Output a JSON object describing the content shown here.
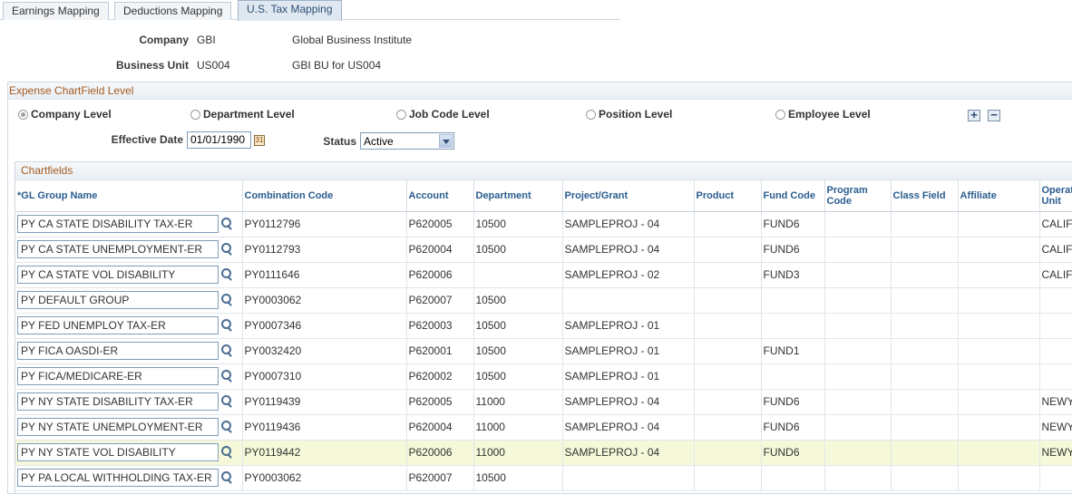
{
  "tabs": [
    {
      "label": "Earnings Mapping"
    },
    {
      "label": "Deductions Mapping"
    },
    {
      "label": "U.S. Tax Mapping"
    }
  ],
  "header": {
    "company_label": "Company",
    "company_code": "GBI",
    "company_name": "Global Business Institute",
    "bu_label": "Business Unit",
    "bu_code": "US004",
    "bu_name": "GBI BU for US004"
  },
  "expense": {
    "title": "Expense ChartField Level",
    "levels": [
      {
        "label": "Company Level",
        "selected": true
      },
      {
        "label": "Department Level",
        "selected": false
      },
      {
        "label": "Job Code Level",
        "selected": false
      },
      {
        "label": "Position Level",
        "selected": false
      },
      {
        "label": "Employee Level",
        "selected": false
      }
    ],
    "add_symbol": "+",
    "remove_symbol": "−",
    "eff_date_label": "Effective Date",
    "eff_date_value": "01/01/1990",
    "status_label": "Status",
    "status_value": "Active"
  },
  "chartfields": {
    "title": "Chartfields",
    "columns": [
      "*GL Group Name",
      "Combination Code",
      "Account",
      "Department",
      "Project/Grant",
      "Product",
      "Fund Code",
      "Program Code",
      "Class Field",
      "Affiliate",
      "Operating Unit"
    ],
    "rows": [
      [
        "PY CA STATE DISABILITY TAX-ER",
        "PY0112796",
        "P620005",
        "10500",
        "SAMPLEPROJ - 04",
        "",
        "FUND6",
        "",
        "",
        "",
        "CALIF"
      ],
      [
        "PY CA STATE UNEMPLOYMENT-ER",
        "PY0112793",
        "P620004",
        "10500",
        "SAMPLEPROJ - 04",
        "",
        "FUND6",
        "",
        "",
        "",
        "CALIF"
      ],
      [
        "PY CA STATE VOL DISABILITY",
        "PY0111646",
        "P620006",
        "",
        "SAMPLEPROJ - 02",
        "",
        "FUND3",
        "",
        "",
        "",
        "CALIF"
      ],
      [
        "PY DEFAULT GROUP",
        "PY0003062",
        "P620007",
        "10500",
        "",
        "",
        "",
        "",
        "",
        "",
        ""
      ],
      [
        "PY FED UNEMPLOY TAX-ER",
        "PY0007346",
        "P620003",
        "10500",
        "SAMPLEPROJ - 01",
        "",
        "",
        "",
        "",
        "",
        ""
      ],
      [
        "PY FICA OASDI-ER",
        "PY0032420",
        "P620001",
        "10500",
        "SAMPLEPROJ - 01",
        "",
        "FUND1",
        "",
        "",
        "",
        ""
      ],
      [
        "PY FICA/MEDICARE-ER",
        "PY0007310",
        "P620002",
        "10500",
        "SAMPLEPROJ - 01",
        "",
        "",
        "",
        "",
        "",
        ""
      ],
      [
        "PY NY STATE DISABILITY TAX-ER",
        "PY0119439",
        "P620005",
        "11000",
        "SAMPLEPROJ - 04",
        "",
        "FUND6",
        "",
        "",
        "",
        "NEWY"
      ],
      [
        "PY NY STATE UNEMPLOYMENT-ER",
        "PY0119436",
        "P620004",
        "11000",
        "SAMPLEPROJ - 04",
        "",
        "FUND6",
        "",
        "",
        "",
        "NEWY"
      ],
      [
        "PY NY STATE VOL DISABILITY",
        "PY0119442",
        "P620006",
        "11000",
        "SAMPLEPROJ - 04",
        "",
        "FUND6",
        "",
        "",
        "",
        "NEWY"
      ],
      [
        "PY PA LOCAL WITHHOLDING TAX-ER",
        "PY0003062",
        "P620007",
        "10500",
        "",
        "",
        "",
        "",
        "",
        "",
        ""
      ]
    ],
    "highlighted_row": 9
  }
}
